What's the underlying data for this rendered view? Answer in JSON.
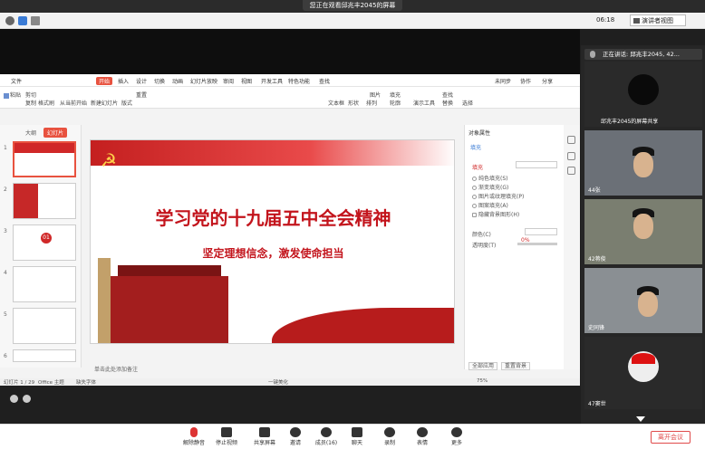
{
  "meeting": {
    "share_banner": "您正在观看邱兆丰2045的屏幕",
    "clock": "06:18",
    "present_view": "演讲者视图",
    "leave_button": "离开会议"
  },
  "ppt": {
    "menu": [
      "文件",
      "开始",
      "插入",
      "设计",
      "切换",
      "动画",
      "幻灯片放映",
      "审阅",
      "视图",
      "开发工具",
      "特色功能",
      "查找"
    ],
    "menu_active": "开始",
    "quick_right": [
      "未同步",
      "协作",
      "分享"
    ],
    "ribbon_left": [
      "粘贴",
      "剪切",
      "复制",
      "格式刷",
      "从当前开始",
      "新建幻灯片",
      "版式",
      "重置"
    ],
    "ribbon_right": [
      "文本框",
      "形状",
      "排列",
      "图片",
      "填充",
      "轮廓",
      "演示工具",
      "查找",
      "替换",
      "选择"
    ],
    "tabs": [
      "大纲",
      "幻灯片"
    ],
    "active_tab": "幻灯片",
    "thumb_numbers": [
      "1",
      "2",
      "3",
      "4",
      "5",
      "6"
    ],
    "thumb_badge": "01",
    "slide_title": "学习党的十九届五中全会精神",
    "slide_subtitle": "坚定理想信念，激发使命担当",
    "notes_placeholder": "单击此处添加备注",
    "status_left": "幻灯片 1 / 29",
    "status_theme": "Office 主题",
    "status_font": "缺失字体",
    "status_beautify": "一键美化",
    "zoom": "75%",
    "right_panel": {
      "title": "对象属性",
      "fill_tab": "填充",
      "fill_section": "填充",
      "options": [
        "纯色填充(S)",
        "渐变填充(G)",
        "图片或纹理填充(P)",
        "图案填充(A)",
        "隐藏背景图形(H)"
      ],
      "color_label": "颜色(C)",
      "transparency_label": "透明度(T)",
      "transparency_value": "0%",
      "apply_all": "全部应用",
      "reset_bg": "重置背景"
    }
  },
  "participants": {
    "speaking": "正在讲话: 邱兆丰2045, 42...",
    "sharer_label": "邱兆丰2045的屏幕共享",
    "tiles": [
      {
        "label": "44张"
      },
      {
        "label": "42蒋俊"
      },
      {
        "label": "史同锋"
      },
      {
        "label": "47窦世"
      }
    ]
  },
  "toolbar": [
    {
      "label": "解除静音",
      "icon": "microphone-icon"
    },
    {
      "label": "停止视频",
      "icon": "video-icon"
    },
    {
      "label": "共享屏幕",
      "icon": "share-screen-icon"
    },
    {
      "label": "邀请",
      "icon": "invite-icon"
    },
    {
      "label": "成员(16)",
      "icon": "members-icon"
    },
    {
      "label": "聊天",
      "icon": "chat-icon"
    },
    {
      "label": "录制",
      "icon": "record-icon"
    },
    {
      "label": "表情",
      "icon": "emoji-icon"
    },
    {
      "label": "更多",
      "icon": "more-icon"
    }
  ]
}
